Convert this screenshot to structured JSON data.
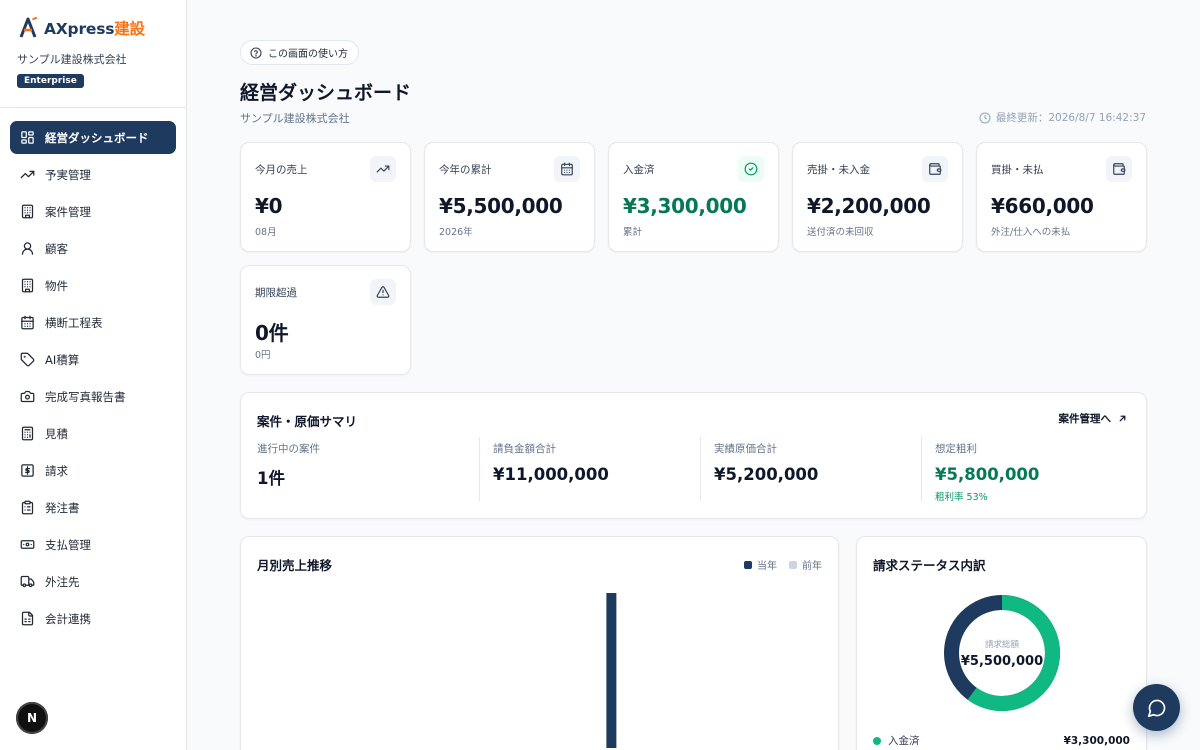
{
  "brand": {
    "name_main": "AXpress",
    "name_accent": "建設",
    "company": "サンプル建設株式会社",
    "plan": "Enterprise"
  },
  "colors": {
    "primary": "#1e3a5f",
    "accent": "#f97316",
    "success": "#047857",
    "donut_paid": "#10b981",
    "prev_year": "#cbd5e1"
  },
  "sidebar": {
    "items": [
      {
        "label": "経営ダッシュボード",
        "icon": "dashboard-grid-icon",
        "active": true
      },
      {
        "label": "予実管理",
        "icon": "trend-up-icon"
      },
      {
        "label": "案件管理",
        "icon": "building-icon"
      },
      {
        "label": "顧客",
        "icon": "user-icon"
      },
      {
        "label": "物件",
        "icon": "building-icon"
      },
      {
        "label": "横断工程表",
        "icon": "calendar-icon"
      },
      {
        "label": "AI積算",
        "icon": "tag-icon"
      },
      {
        "label": "完成写真報告書",
        "icon": "camera-icon"
      },
      {
        "label": "見積",
        "icon": "calculator-icon"
      },
      {
        "label": "請求",
        "icon": "dollar-icon"
      },
      {
        "label": "発注書",
        "icon": "clipboard-icon"
      },
      {
        "label": "支払管理",
        "icon": "banknote-icon"
      },
      {
        "label": "外注先",
        "icon": "truck-icon"
      },
      {
        "label": "会計連携",
        "icon": "spreadsheet-icon"
      }
    ],
    "avatar_letter": "N"
  },
  "header": {
    "help_label": "この画面の使い方",
    "title": "経営ダッシュボード",
    "subtitle": "サンプル建設株式会社",
    "last_updated": "最終更新：2026/8/7 16:42:37"
  },
  "kpis": [
    {
      "label": "今月の売上",
      "value": "¥0",
      "sub": "08月",
      "icon": "trend-up-icon"
    },
    {
      "label": "今年の累計",
      "value": "¥5,500,000",
      "sub": "2026年",
      "icon": "calendar-icon"
    },
    {
      "label": "入金済",
      "value": "¥3,300,000",
      "sub": "累計",
      "icon": "check-circle-icon"
    },
    {
      "label": "売掛・未入金",
      "value": "¥2,200,000",
      "sub": "送付済の未回収",
      "icon": "wallet-icon"
    },
    {
      "label": "買掛・未払",
      "value": "¥660,000",
      "sub": "外注/仕入への未払",
      "icon": "wallet-icon"
    },
    {
      "label": "期限超過",
      "value": "0件",
      "sub": "0円",
      "icon": "warning-icon"
    }
  ],
  "summary": {
    "title": "案件・原価サマリ",
    "link_label": "案件管理へ",
    "metrics": [
      {
        "label": "進行中の案件",
        "value": "1件"
      },
      {
        "label": "請負金額合計",
        "value": "¥11,000,000"
      },
      {
        "label": "実績原価合計",
        "value": "¥5,200,000"
      },
      {
        "label": "想定粗利",
        "value": "¥5,800,000",
        "sub": "粗利率 53%"
      }
    ]
  },
  "monthly_chart": {
    "title": "月別売上推移",
    "legend_current": "当年",
    "legend_previous": "前年"
  },
  "chart_data": {
    "type": "bar",
    "categories": [
      "",
      "",
      "",
      "",
      "",
      "",
      "",
      "",
      "",
      "",
      "",
      ""
    ],
    "series": [
      {
        "name": "当年",
        "values": [
          0,
          0,
          0,
          0,
          0,
          0,
          0,
          5500000,
          0,
          0,
          0,
          0
        ]
      },
      {
        "name": "前年",
        "values": [
          0,
          0,
          0,
          0,
          0,
          0,
          0,
          0,
          0,
          0,
          0,
          0
        ]
      }
    ],
    "title": "月別売上推移",
    "legend": "top-right",
    "grid": false
  },
  "invoice_status": {
    "title": "請求ステータス内訳",
    "center_label": "請求総額",
    "center_value": "¥5,500,000",
    "paid_fraction": 0.6,
    "rows": [
      {
        "label": "入金済",
        "amount": "¥3,300,000",
        "color": "#10b981"
      }
    ]
  }
}
